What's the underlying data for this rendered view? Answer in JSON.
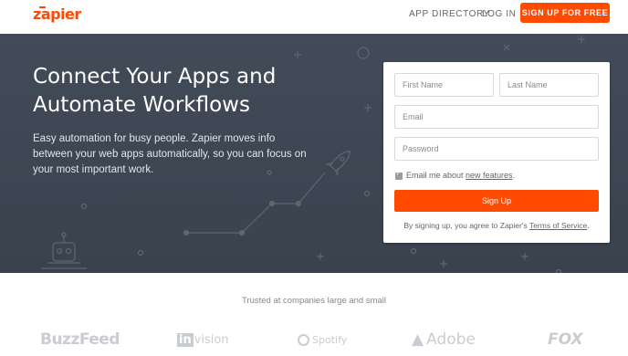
{
  "header": {
    "logo_text": "zapier",
    "nav": {
      "app_directory": "APP DIRECTORY",
      "log_in": "LOG IN",
      "signup_button": "SIGN UP FOR FREE"
    }
  },
  "hero": {
    "title": "Connect Your Apps and Automate Workflows",
    "description": "Easy automation for busy people. Zapier moves info between your web apps automatically, so you can focus on your most important work."
  },
  "signup_form": {
    "first_name_placeholder": "First Name",
    "last_name_placeholder": "Last Name",
    "email_placeholder": "Email",
    "password_placeholder": "Password",
    "email_opt_in_text": "Email me about ",
    "email_opt_in_link": "new features",
    "email_opt_in_suffix": ".",
    "email_opt_in_checked": true,
    "submit_label": "Sign Up",
    "terms_prefix": "By signing up, you agree to Zapier's ",
    "terms_link": "Terms of Service",
    "terms_suffix": "."
  },
  "trusted": {
    "heading": "Trusted at companies large and small",
    "logos": [
      "BuzzFeed",
      "InVision",
      "Spotify",
      "Adobe",
      "FOX"
    ],
    "invision_prefix": "in",
    "invision_rest": "vision"
  },
  "colors": {
    "brand_orange": "#ff4a00",
    "hero_background": "#3e4652"
  }
}
